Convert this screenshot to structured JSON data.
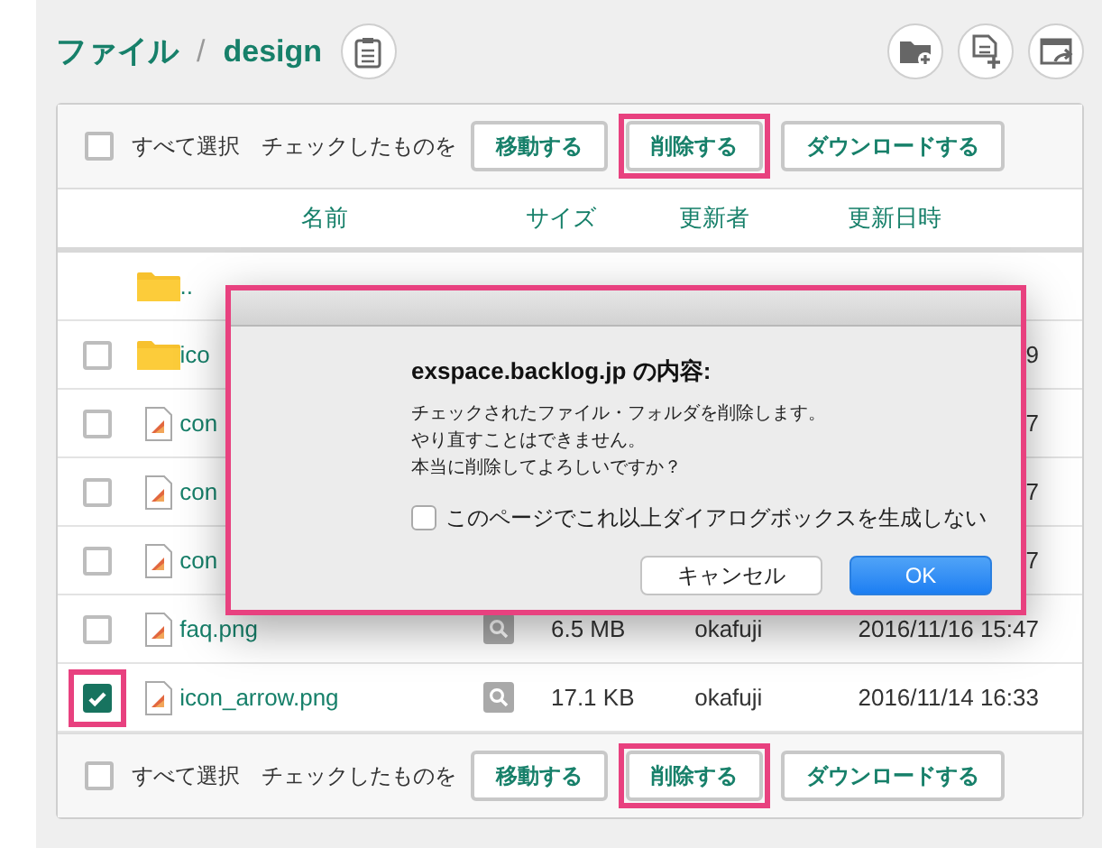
{
  "breadcrumb": [
    {
      "label": "ファイル"
    },
    {
      "label": "design"
    }
  ],
  "breadcrumb_separator": "/",
  "toolbars": [
    {
      "select_all": {
        "label": "すべて選択",
        "checked": false
      },
      "prompt": "チェックしたものを",
      "buttons": [
        {
          "label": "移動する",
          "highlighted": false
        },
        {
          "label": "削除する",
          "highlighted": true
        },
        {
          "label": "ダウンロードする",
          "highlighted": false
        }
      ]
    },
    {
      "select_all": {
        "label": "すべて選択",
        "checked": false
      },
      "prompt": "チェックしたものを",
      "buttons": [
        {
          "label": "移動する",
          "highlighted": false
        },
        {
          "label": "削除する",
          "highlighted": true
        },
        {
          "label": "ダウンロードする",
          "highlighted": false
        }
      ]
    }
  ],
  "columns": [
    "名前",
    "サイズ",
    "更新者",
    "更新日時"
  ],
  "rows": [
    {
      "kind": "parent",
      "name": ".."
    },
    {
      "kind": "folder",
      "name": "ico",
      "checked": false,
      "highlighted": false,
      "date": "9"
    },
    {
      "kind": "file",
      "name": "con",
      "checked": false,
      "highlighted": false,
      "date": "7"
    },
    {
      "kind": "file",
      "name": "con",
      "checked": false,
      "highlighted": false,
      "date": "7"
    },
    {
      "kind": "file",
      "name": "con",
      "checked": false,
      "highlighted": false,
      "date": "7"
    },
    {
      "kind": "file",
      "name": "faq.png",
      "checked": false,
      "highlighted": false,
      "preview": true,
      "size": "6.5 MB",
      "updater": "okafuji",
      "date": "2016/11/16 15:47"
    },
    {
      "kind": "file",
      "name": "icon_arrow.png",
      "checked": true,
      "highlighted": true,
      "preview": true,
      "size": "17.1 KB",
      "updater": "okafuji",
      "date": "2016/11/14 16:33"
    }
  ],
  "dialog": {
    "highlighted": true,
    "title": "exspace.backlog.jp の内容:",
    "message_lines": [
      "チェックされたファイル・フォルダを削除します。",
      "やり直すことはできません。",
      "本当に削除してよろしいですか？"
    ],
    "suppress": {
      "label": "このページでこれ以上ダイアログボックスを生成しない",
      "checked": false
    },
    "buttons": [
      {
        "kind": "cancel",
        "label": "キャンセル"
      },
      {
        "kind": "ok",
        "label": "OK"
      }
    ]
  }
}
